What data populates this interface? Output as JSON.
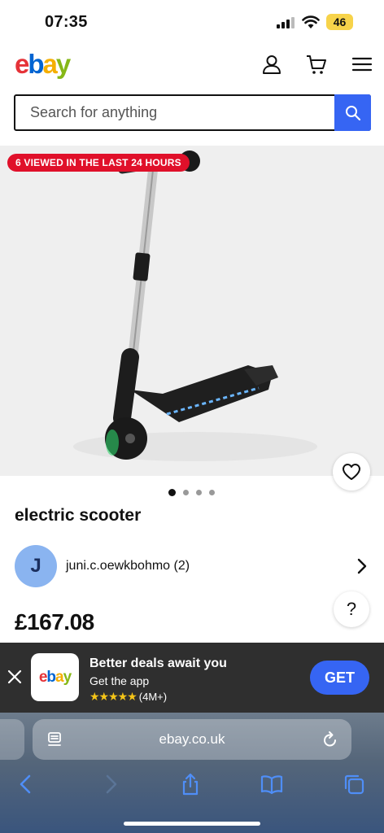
{
  "status_bar": {
    "time": "07:35",
    "battery": "46"
  },
  "header": {
    "logo": {
      "e": "e",
      "b": "b",
      "a": "a",
      "y": "y"
    }
  },
  "search": {
    "placeholder": "Search for anything"
  },
  "product": {
    "badge": "6 VIEWED IN THE LAST 24 HOURS",
    "title": "electric scooter",
    "price": "£167.08",
    "image_count": 4,
    "active_image": 1
  },
  "seller": {
    "initial": "J",
    "name": "juni.c.oewkbohmo (2)"
  },
  "help": {
    "label": "?"
  },
  "app_banner": {
    "logo": {
      "e": "e",
      "b": "b",
      "a": "a",
      "y": "y"
    },
    "title": "Better deals await you",
    "subtitle": "Get the app",
    "stars": "★★★★★",
    "rating_count": "(4M+)",
    "cta": "GET"
  },
  "browser": {
    "url": "ebay.co.uk"
  },
  "colors": {
    "accent": "#3665f3",
    "badge": "#e0102a",
    "avatar": "#8ab4f0"
  }
}
